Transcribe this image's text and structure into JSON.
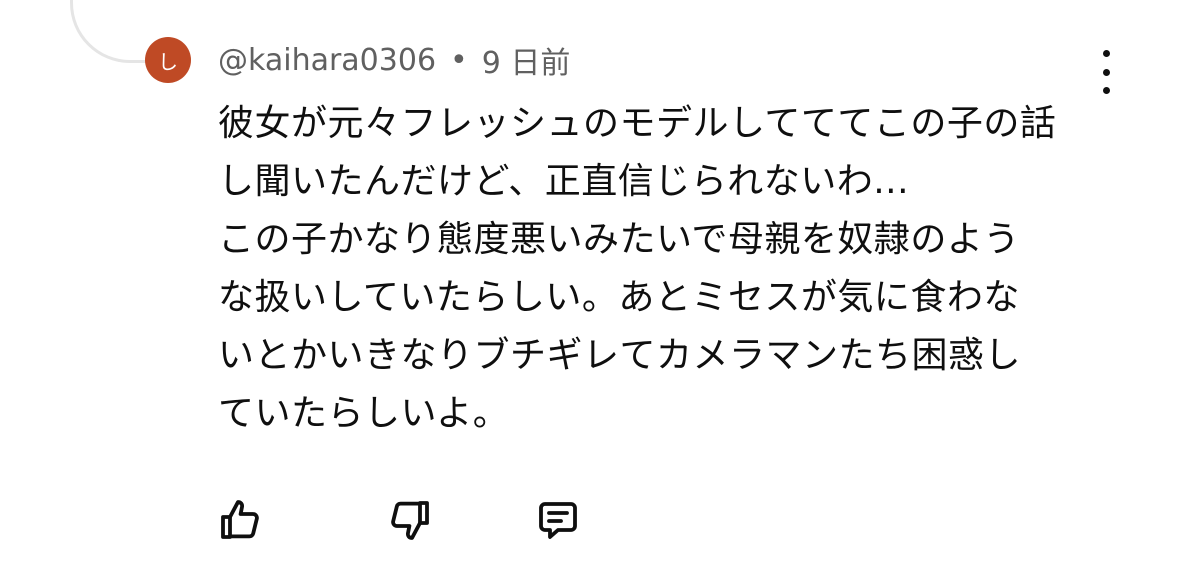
{
  "comment": {
    "avatar_letter": "し",
    "avatar_color": "#bf4a25",
    "author": "@kaihara0306",
    "separator": "•",
    "timestamp": "9 日前",
    "text": "彼女が元々フレッシュのモデルしてててこの子の話\nし聞いたんだけど、正直信じられないわ...\nこの子かなり態度悪いみたいで母親を奴隷のよう\nな扱いしていたらしい。あとミセスが気に食わな\nいとかいきなりブチギレてカメラマンたち困惑し\nていたらしいよ。"
  },
  "actions": {
    "like_icon": "thumbs-up-icon",
    "dislike_icon": "thumbs-down-icon",
    "reply_icon": "comment-reply-icon",
    "more_icon": "more-vertical-icon"
  }
}
